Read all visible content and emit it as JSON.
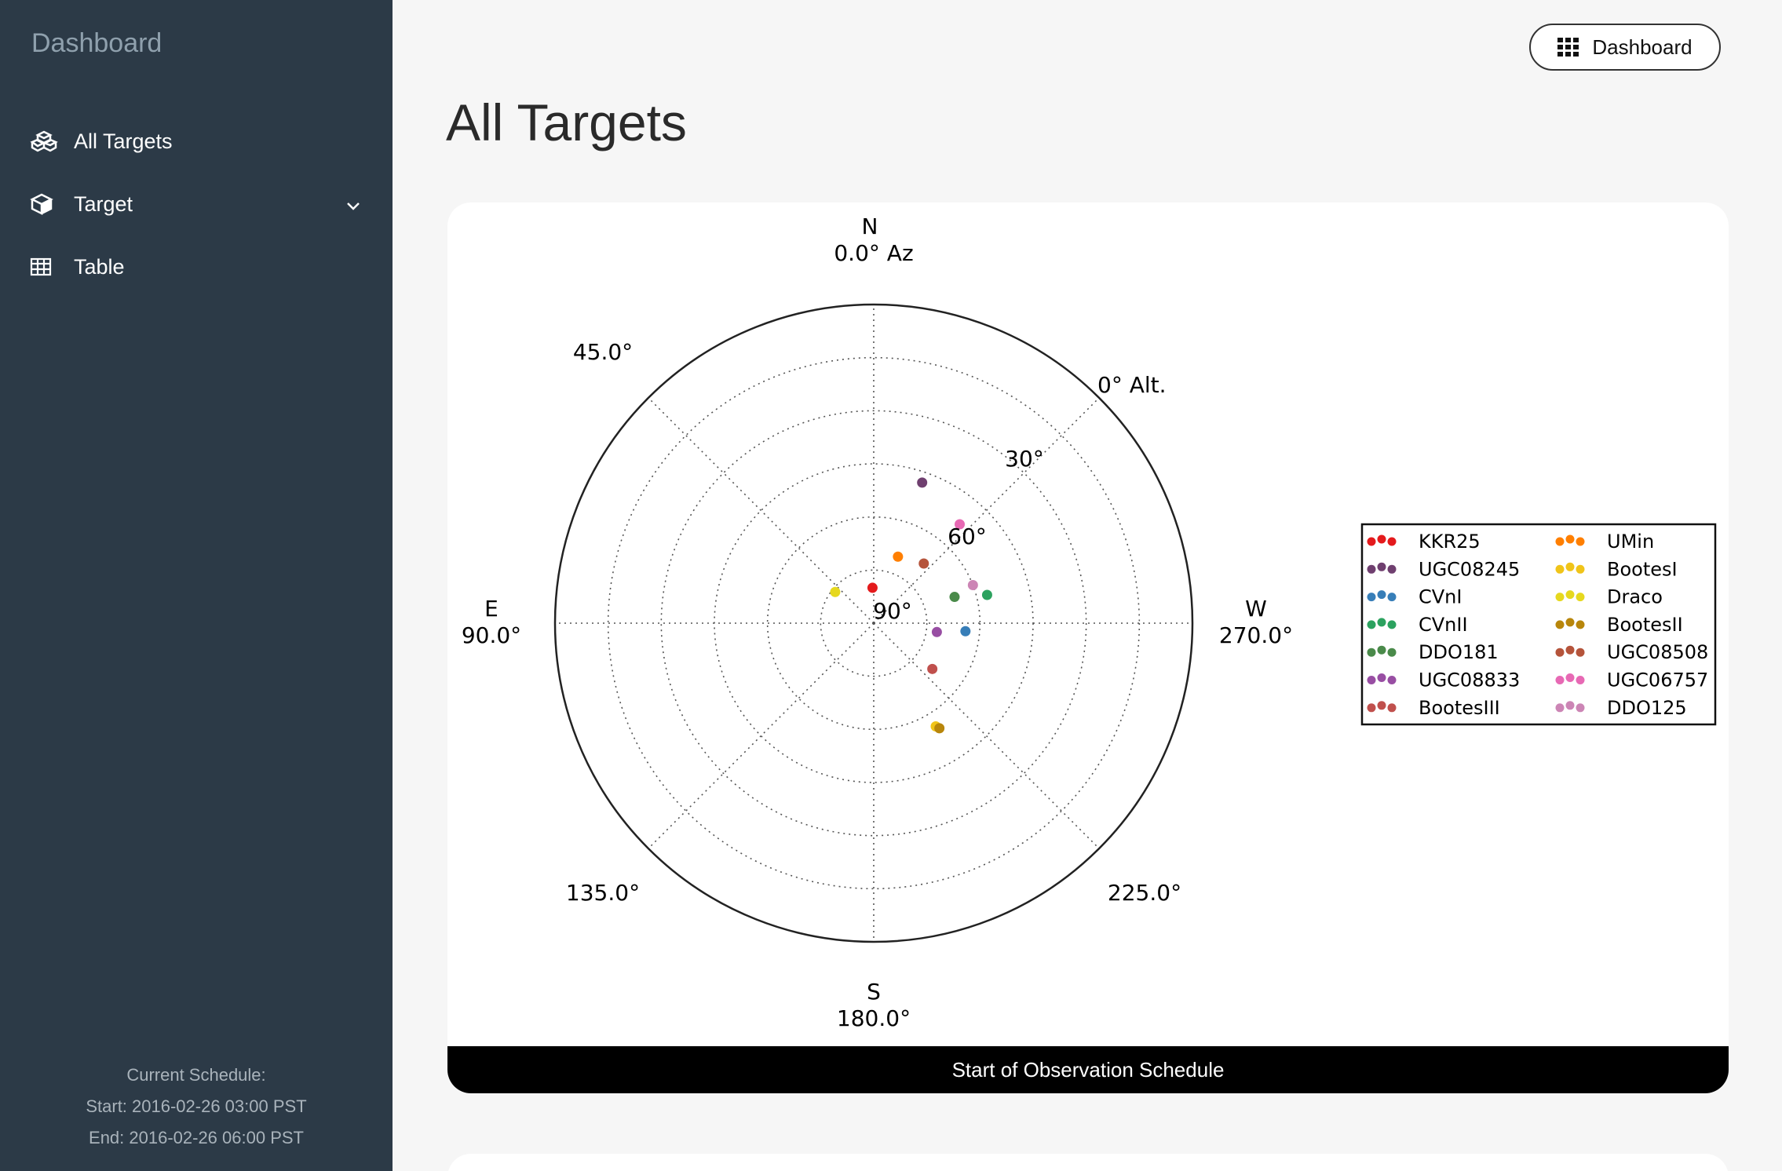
{
  "sidebar": {
    "brand": "Dashboard",
    "items": [
      {
        "label": "All Targets",
        "icon": "cubes-icon"
      },
      {
        "label": "Target",
        "icon": "cube-icon",
        "has_dropdown": true
      },
      {
        "label": "Table",
        "icon": "table-icon"
      }
    ],
    "schedule": {
      "heading": "Current Schedule:",
      "start": "Start: 2016-02-26 03:00 PST",
      "end": "End: 2016-02-26 06:00 PST"
    }
  },
  "header": {
    "button_label": "Dashboard",
    "button_icon": "grid-icon",
    "page_title": "All Targets"
  },
  "card": {
    "caption": "Start of Observation Schedule"
  },
  "chart_data": {
    "type": "scatter",
    "projection": "polar-sky",
    "compass": {
      "n": "N",
      "n_az": "0.0° Az",
      "e": "E",
      "e_az": "90.0°",
      "s": "S",
      "s_az": "180.0°",
      "w": "W",
      "w_az": "270.0°",
      "ne": "45.0°",
      "se": "135.0°",
      "sw": "225.0°",
      "alt_label": "0° Alt."
    },
    "radial_ticks": [
      "30°",
      "60°",
      "90°"
    ],
    "grid": true,
    "legend_position": "right",
    "series": [
      {
        "name": "KKR25",
        "color": "#e41a1c",
        "az": 2,
        "alt": 80
      },
      {
        "name": "UGC08245",
        "color": "#6f3f6f",
        "az": 341,
        "alt": 48
      },
      {
        "name": "CVnI",
        "color": "#377eb8",
        "az": 265,
        "alt": 64
      },
      {
        "name": "CVnII",
        "color": "#2ca25f",
        "az": 284,
        "alt": 57
      },
      {
        "name": "DDO181",
        "color": "#4a8a4a",
        "az": 288,
        "alt": 66
      },
      {
        "name": "UGC08833",
        "color": "#984ea3",
        "az": 262,
        "alt": 72
      },
      {
        "name": "BootesIII",
        "color": "#c0504d",
        "az": 232,
        "alt": 69
      },
      {
        "name": "UMin",
        "color": "#ff7f00",
        "az": 340,
        "alt": 70
      },
      {
        "name": "BootesI",
        "color": "#f0c419",
        "az": 211,
        "alt": 56
      },
      {
        "name": "Draco",
        "color": "#e6d81e",
        "az": 51,
        "alt": 76
      },
      {
        "name": "BootesII",
        "color": "#b8860b",
        "az": 212,
        "alt": 55
      },
      {
        "name": "UGC08508",
        "color": "#b5543b",
        "az": 320,
        "alt": 68
      },
      {
        "name": "UGC06757",
        "color": "#e769b4",
        "az": 319,
        "alt": 53
      },
      {
        "name": "DDO125",
        "color": "#cc85b5",
        "az": 291,
        "alt": 60
      }
    ]
  }
}
